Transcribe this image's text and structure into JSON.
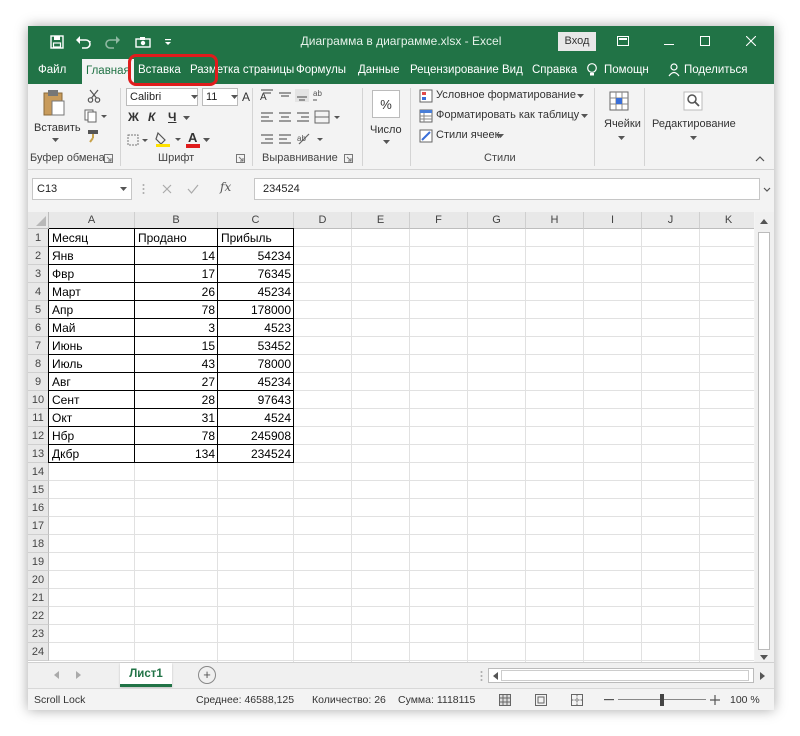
{
  "titlebar": {
    "title": "Диаграмма в диаграмме.xlsx  -  Excel",
    "signin": "Вход",
    "save_icon": "save-icon",
    "undo_icon": "undo-icon",
    "redo_icon": "redo-icon",
    "camera_icon": "camera-icon",
    "customize_icon": "customize-qat-icon"
  },
  "tabs": [
    "Файл",
    "Главная",
    "Вставка",
    "Разметка страницы",
    "Формулы",
    "Данные",
    "Рецензирование",
    "Вид",
    "Справка",
    "Помощн",
    "Поделиться"
  ],
  "ribbon": {
    "clipboard": {
      "paste": "Вставить",
      "label": "Буфер обмена"
    },
    "font": {
      "name": "Calibri",
      "size": "11",
      "bold": "Ж",
      "italic": "К",
      "underline": "Ч",
      "grow": "A",
      "shrink": "A",
      "fontcolor": "A",
      "label": "Шрифт"
    },
    "alignment": {
      "label": "Выравнивание"
    },
    "number": {
      "percent": "%",
      "label": "Число"
    },
    "styles": {
      "conditional": "Условное форматирование",
      "table": "Форматировать как таблицу",
      "cellstyles": "Стили ячеек",
      "label": "Стили"
    },
    "cells": {
      "label": "Ячейки"
    },
    "editing": {
      "label": "Редактирование"
    }
  },
  "formula": {
    "namebox": "C13",
    "fx": "fx",
    "value": "234524"
  },
  "columns": [
    "A",
    "B",
    "C",
    "D",
    "E",
    "F",
    "G",
    "H",
    "I",
    "J",
    "K"
  ],
  "rows": [
    "1",
    "2",
    "3",
    "4",
    "5",
    "6",
    "7",
    "8",
    "9",
    "10",
    "11",
    "12",
    "13",
    "14",
    "15",
    "16",
    "17",
    "18",
    "19",
    "20",
    "21",
    "22",
    "23",
    "24"
  ],
  "table": {
    "headers": [
      "Месяц",
      "Продано",
      "Прибыль"
    ],
    "data": [
      [
        "Янв",
        "14",
        "54234"
      ],
      [
        "Фвр",
        "17",
        "76345"
      ],
      [
        "Март",
        "26",
        "45234"
      ],
      [
        "Апр",
        "78",
        "178000"
      ],
      [
        "Май",
        "3",
        "4523"
      ],
      [
        "Июнь",
        "15",
        "53452"
      ],
      [
        "Июль",
        "43",
        "78000"
      ],
      [
        "Авг",
        "27",
        "45234"
      ],
      [
        "Сент",
        "28",
        "97643"
      ],
      [
        "Окт",
        "31",
        "4524"
      ],
      [
        "Нбр",
        "78",
        "245908"
      ],
      [
        "Дкбр",
        "134",
        "234524"
      ]
    ]
  },
  "sheet": {
    "name": "Лист1",
    "add": "+"
  },
  "status": {
    "mode": "Scroll Lock",
    "average": "Среднее: 46588,125",
    "count": "Количество: 26",
    "sum": "Сумма: 1118115",
    "zoom": "100 %",
    "zoom_level": 1.0
  },
  "colors": {
    "accent": "#217346",
    "highlight": "#e01c1c"
  }
}
